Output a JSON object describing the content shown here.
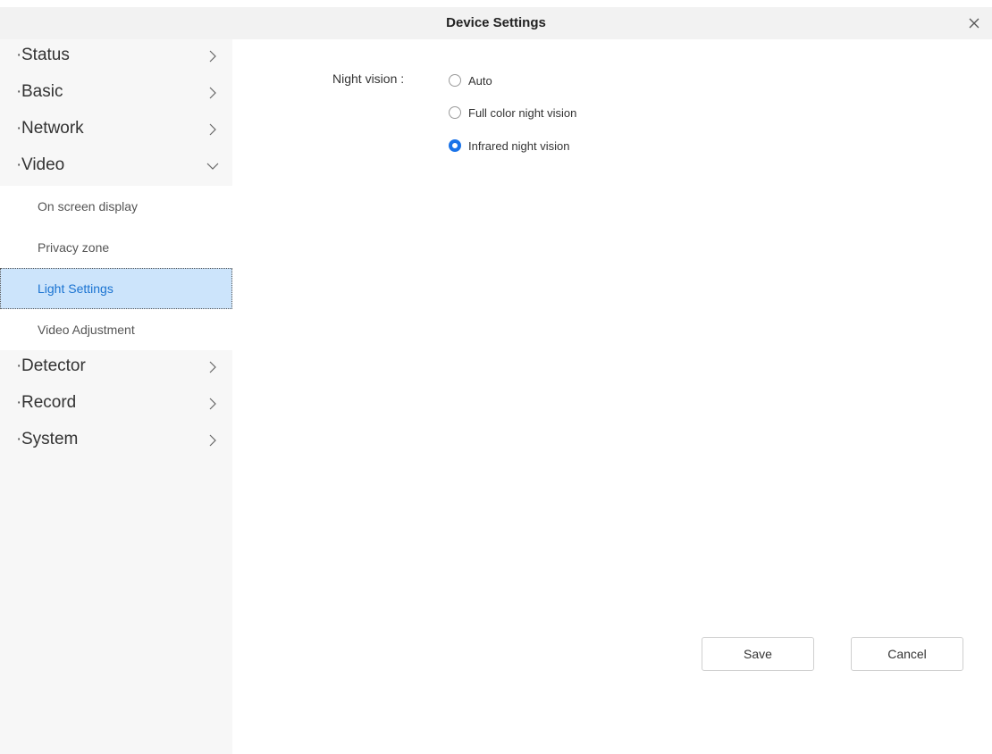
{
  "window": {
    "title": "Device Settings",
    "close_icon": "close-icon"
  },
  "sidebar": {
    "items": [
      {
        "label": "Status",
        "expanded": false
      },
      {
        "label": "Basic",
        "expanded": false
      },
      {
        "label": "Network",
        "expanded": false
      },
      {
        "label": "Video",
        "expanded": true
      },
      {
        "label": "Detector",
        "expanded": false
      },
      {
        "label": "Record",
        "expanded": false
      },
      {
        "label": "System",
        "expanded": false
      }
    ],
    "video_submenu": [
      {
        "label": "On screen display",
        "active": false
      },
      {
        "label": "Privacy zone",
        "active": false
      },
      {
        "label": "Light Settings",
        "active": true
      },
      {
        "label": "Video Adjustment",
        "active": false
      }
    ]
  },
  "main": {
    "night_vision": {
      "label": "Night vision :",
      "options": [
        {
          "label": "Auto",
          "checked": false
        },
        {
          "label": "Full color night vision",
          "checked": false
        },
        {
          "label": "Infrared night vision",
          "checked": true
        }
      ]
    }
  },
  "footer": {
    "save_label": "Save",
    "cancel_label": "Cancel"
  },
  "colors": {
    "accent": "#1a73e8",
    "active_bg": "#cce4fb",
    "sidebar_bg": "#f7f7f7",
    "titlebar_bg": "#f2f2f2"
  }
}
